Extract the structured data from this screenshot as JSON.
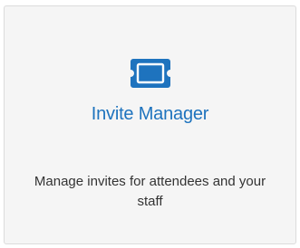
{
  "card": {
    "icon": "ticket-icon",
    "title": "Invite Manager",
    "description": "Manage invites for attendees and your staff",
    "accent_color": "#1e73be"
  }
}
